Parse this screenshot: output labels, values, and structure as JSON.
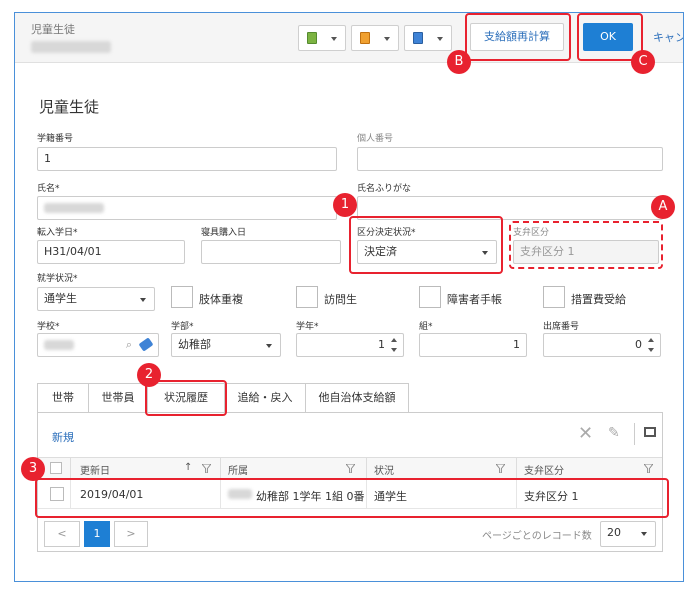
{
  "header": {
    "breadcrumb": "児童生徒",
    "recalc_button": "支給額再計算",
    "ok_button": "OK",
    "cancel_button": "キャン"
  },
  "page_title": "児童生徒",
  "form": {
    "student_no_label": "学籍番号",
    "student_no_value": "1",
    "personal_no_label": "個人番号",
    "name_label": "氏名*",
    "name_kana_label": "氏名ふりがな",
    "transfer_date_label": "転入学日*",
    "transfer_date_value": "H31/04/01",
    "supplies_date_label": "寝具購入日",
    "decision_label": "区分決定状況*",
    "decision_value": "決定済",
    "payment_class_label": "支弁区分",
    "payment_class_value": "支弁区分 1",
    "enrollment_label": "就学状況*",
    "enrollment_value": "通学生",
    "cb_body": "肢体重複",
    "cb_visiting": "訪問生",
    "cb_disability": "障害者手帳",
    "cb_measure": "措置費受給",
    "school_label": "学校*",
    "dept_label": "学部*",
    "dept_value": "幼稚部",
    "grade_label": "学年*",
    "grade_value": "1",
    "class_label": "組*",
    "class_value": "1",
    "attendance_label": "出席番号",
    "attendance_value": "0"
  },
  "tabs": [
    "世帯",
    "世帯員",
    "状況履歴",
    "追給・戻入",
    "他自治体支給額"
  ],
  "grid": {
    "new_link": "新規",
    "columns": [
      "更新日",
      "所属",
      "状況",
      "支弁区分"
    ],
    "sort_arrow": "↑",
    "rows": [
      {
        "date": "2019/04/01",
        "affiliation": "幼稚部 1学年 1組 0番",
        "status": "通学生",
        "payment": "支弁区分 1"
      }
    ],
    "page": "1",
    "per_page_label": "ページごとのレコード数",
    "per_page_value": "20"
  },
  "annotations": [
    "B",
    "C",
    "1",
    "A",
    "2",
    "3"
  ],
  "colors": {
    "accent": "#1e7fd4",
    "annotation": "#e8222f",
    "link": "#2c6fbb"
  }
}
